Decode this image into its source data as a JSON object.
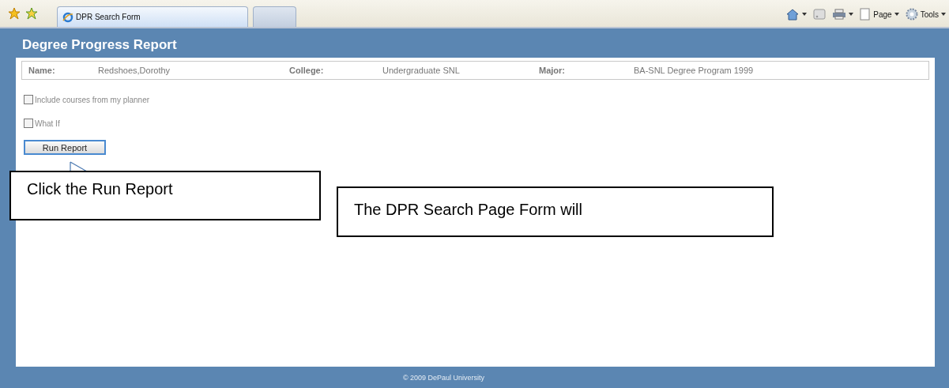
{
  "browser": {
    "tabs": [
      {
        "label": "DPR Search Form",
        "selected": true
      },
      {
        "selected": false
      }
    ],
    "commands": [
      {
        "kind": "home"
      },
      {
        "kind": "feed"
      },
      {
        "kind": "print"
      },
      {
        "kind": "page",
        "label": "Page"
      },
      {
        "kind": "tools",
        "label": "Tools"
      }
    ]
  },
  "page": {
    "title": "Degree Progress Report",
    "info": [
      {
        "label": "Name:",
        "value": "Redshoes,Dorothy"
      },
      {
        "label": "College:",
        "value": "Undergraduate SNL"
      },
      {
        "label": "Major:",
        "value": "BA-SNL Degree Program 1999"
      }
    ],
    "options": [
      {
        "label": "Include courses from my planner",
        "checked": false
      },
      {
        "label": "What If",
        "checked": false
      }
    ],
    "button": "Run Report",
    "footer": "© 2009 DePaul University"
  },
  "callouts": [
    {
      "text": "Click the Run Report"
    },
    {
      "text": "The DPR Search Page Form will"
    }
  ]
}
